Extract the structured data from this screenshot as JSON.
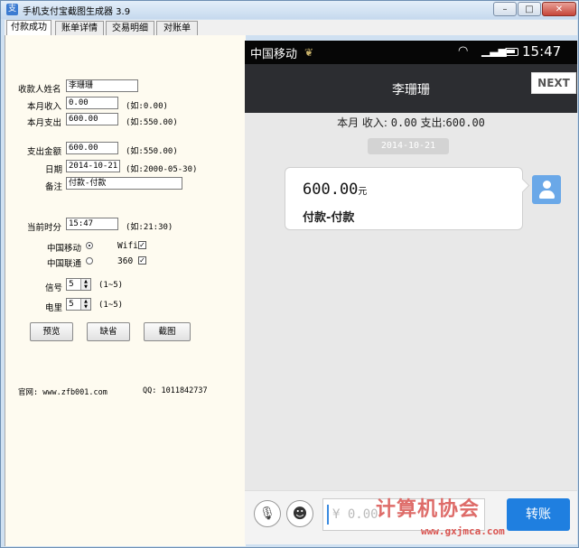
{
  "window": {
    "title": "手机支付宝截图生成器 3.9",
    "controls": {
      "min": "–",
      "max": "□",
      "close": "✕"
    }
  },
  "tabs": [
    {
      "label": "付款成功",
      "active": true
    },
    {
      "label": "账单详情",
      "active": false
    },
    {
      "label": "交易明细",
      "active": false
    },
    {
      "label": "对账单",
      "active": false
    }
  ],
  "form": {
    "payee_label": "收款人姓名",
    "payee_value": "李珊珊",
    "income_label": "本月收入",
    "income_value": "0.00",
    "income_hint": "(如:0.00)",
    "expense_label": "本月支出",
    "expense_value": "600.00",
    "expense_hint": "(如:550.00)",
    "amount_label": "支出金额",
    "amount_value": "600.00",
    "amount_hint": "(如:550.00)",
    "date_label": "日期",
    "date_value": "2014-10-21",
    "date_hint": "(如:2000-05-30)",
    "note_label": "备注",
    "note_value": "付款-付款",
    "time_label": "当前时分",
    "time_value": "15:47",
    "time_hint": "(如:21:30)",
    "carrier1_label": "中国移动",
    "carrier2_label": "中国联通",
    "wifi_label": "Wifi",
    "net360_label": "360",
    "signal_label": "信号",
    "signal_value": "5",
    "signal_hint": "(1~5)",
    "battery_label": "电里",
    "battery_value": "5",
    "battery_hint": "(1~5)",
    "preview_btn": "预览",
    "default_btn": "缺省",
    "capture_btn": "截图",
    "website": "官网: www.zfb001.com",
    "qq": "QQ: 1011842737",
    "wifi_check": "✓",
    "net360_check": "✓"
  },
  "phone": {
    "carrier": "中国移动",
    "time": "15:47",
    "chat_title": "李珊珊",
    "next_label": "NEXT",
    "summary_prefix": "本月 收入:",
    "summary_income": "0.00",
    "summary_mid": "支出:",
    "summary_expense": "600.00",
    "date_chip": "2014-10-21",
    "bubble_amount": "600.00",
    "bubble_unit": "元",
    "bubble_note": "付款-付款",
    "input_placeholder": "¥ 0.00",
    "send_label": "转账"
  },
  "watermark": {
    "text": "计算机协会",
    "site": "www.gxjmca.com"
  }
}
